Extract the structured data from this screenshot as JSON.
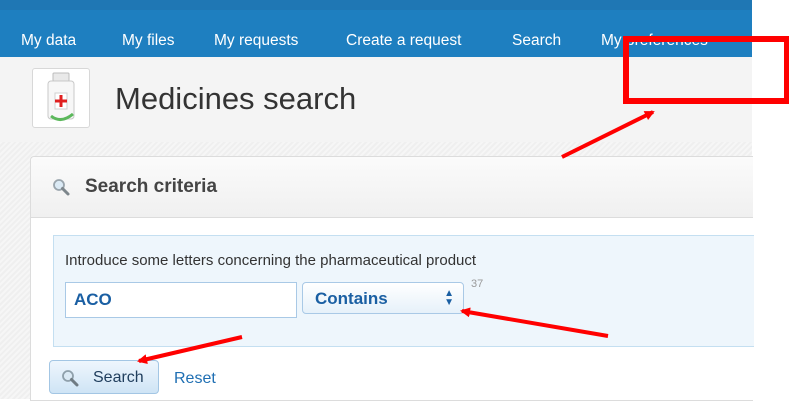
{
  "nav": {
    "items": [
      "My data",
      "My files",
      "My requests",
      "Create a request",
      "Search",
      "My preferences"
    ]
  },
  "page": {
    "title": "Medicines search"
  },
  "panel": {
    "title": "Search criteria",
    "instruction": "Introduce some letters concerning the pharmaceutical product",
    "input_value": "ACO",
    "match_select": "Contains",
    "result_count": "37"
  },
  "actions": {
    "search_label": "Search",
    "reset_label": "Reset"
  },
  "icons": {
    "logo": "medicine-bottle-icon",
    "panel": "magnifier-icon",
    "button": "magnifier-icon",
    "select": "updown-arrows-icon"
  },
  "colors": {
    "topbar": "#1e7fc0",
    "accent_text": "#1a5fa3",
    "annotation": "#ff0000"
  }
}
